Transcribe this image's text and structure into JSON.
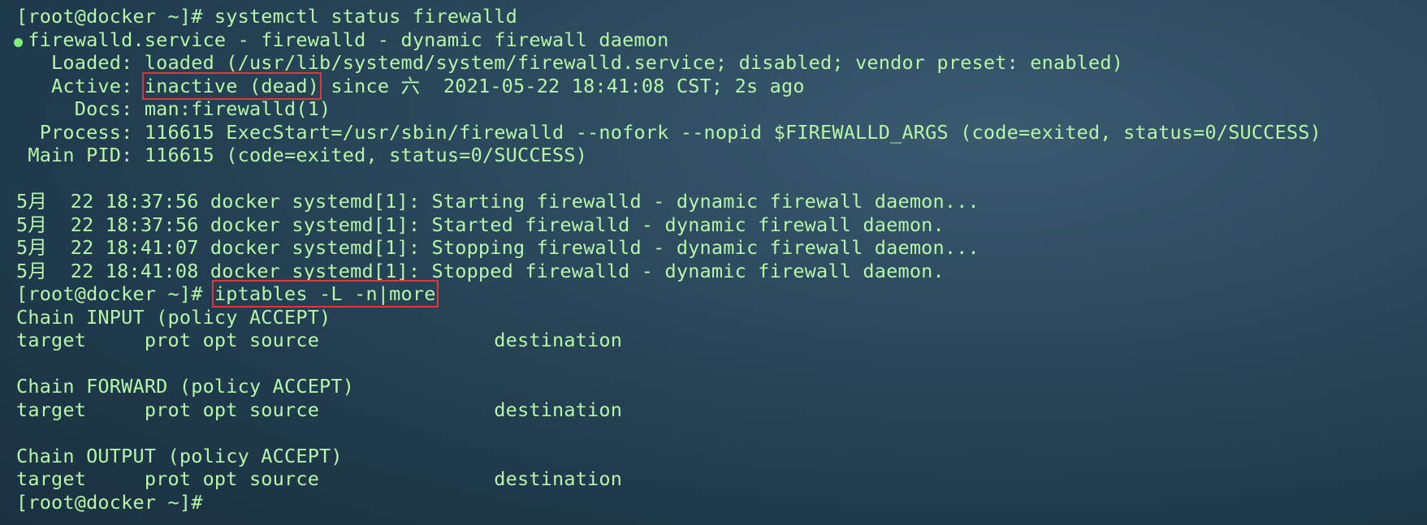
{
  "terminal": {
    "lines": [
      "[root@docker ~]# systemctl status firewalld",
      " firewalld.service - firewalld - dynamic firewall daemon",
      "   Loaded: loaded (/usr/lib/systemd/system/firewalld.service; disabled; vendor preset: enabled)",
      "   Active: ",
      "inactive (dead)",
      " since 六  2021-05-22 18:41:08 CST; 2s ago",
      "     Docs: man:firewalld(1)",
      "  Process: 116615 ExecStart=/usr/sbin/firewalld --nofork --nopid $FIREWALLD_ARGS (code=exited, status=0/SUCCESS)",
      " Main PID: 116615 (code=exited, status=0/SUCCESS)",
      "",
      "5月  22 18:37:56 docker systemd[1]: Starting firewalld - dynamic firewall daemon...",
      "5月  22 18:37:56 docker systemd[1]: Started firewalld - dynamic firewall daemon.",
      "5月  22 18:41:07 docker systemd[1]: Stopping firewalld - dynamic firewall daemon...",
      "5月  22 18:41:08 docker systemd[1]: Stopped firewalld - dynamic firewall daemon.",
      "[root@docker ~]# ",
      "iptables -L -n|more",
      "Chain INPUT (policy ACCEPT)",
      "target     prot opt source               destination",
      "",
      "Chain FORWARD (policy ACCEPT)",
      "target     prot opt source               destination",
      "",
      "Chain OUTPUT (policy ACCEPT)",
      "target     prot opt source               destination",
      "[root@docker ~]# "
    ],
    "status_dot_color": "#7ef07a",
    "text_color": "#b7f5a8",
    "highlight_color": "#e0363a"
  }
}
